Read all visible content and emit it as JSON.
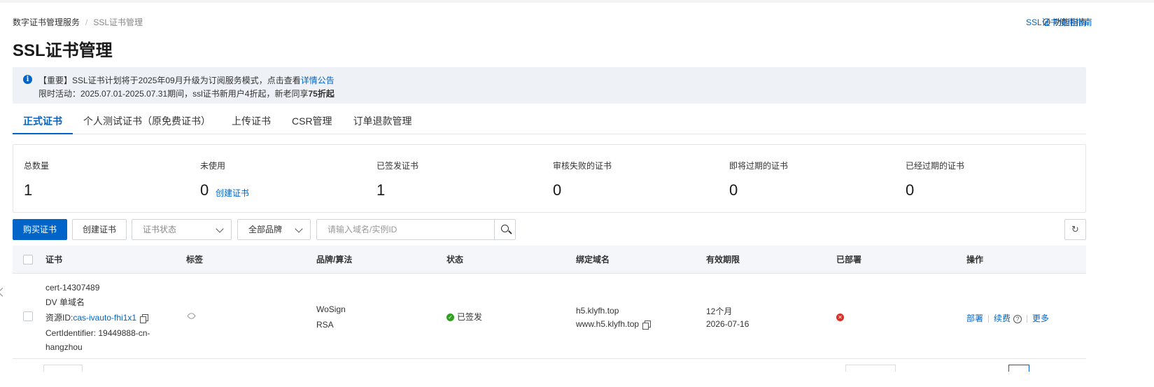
{
  "breadcrumb": {
    "root": "数字证书管理服务",
    "separator": "/",
    "current": "SSL证书管理"
  },
  "header": {
    "guide_label": "功能指南",
    "usage_guide_label": "SSL证书使用指南",
    "title": "SSL证书管理"
  },
  "notice": {
    "line1_prefix": "【重要】SSL证书计划将于2025年09月升级为订阅服务模式，点击查看",
    "line1_link": "详情公告",
    "line2_prefix": "限时活动：2025.07.01-2025.07.31期间，ssl证书新用户4折起，新老同享",
    "line2_bold": "75折起"
  },
  "tabs": [
    {
      "label": "正式证书",
      "active": true
    },
    {
      "label": "个人测试证书（原免费证书）",
      "active": false
    },
    {
      "label": "上传证书",
      "active": false
    },
    {
      "label": "CSR管理",
      "active": false
    },
    {
      "label": "订单退款管理",
      "active": false
    }
  ],
  "stats": [
    {
      "label": "总数量",
      "value": "1"
    },
    {
      "label": "未使用",
      "value": "0",
      "link": "创建证书"
    },
    {
      "label": "已签发证书",
      "value": "1"
    },
    {
      "label": "审核失败的证书",
      "value": "0"
    },
    {
      "label": "即将过期的证书",
      "value": "0"
    },
    {
      "label": "已经过期的证书",
      "value": "0"
    }
  ],
  "toolbar": {
    "buy_label": "购买证书",
    "create_label": "创建证书",
    "status_placeholder": "证书状态",
    "brand_value": "全部品牌",
    "search_placeholder": "请输入域名/实例ID",
    "refresh_glyph": "↻"
  },
  "table": {
    "columns": [
      "证书",
      "标签",
      "品牌/算法",
      "状态",
      "绑定域名",
      "有效期限",
      "已部署",
      "操作"
    ],
    "rows": [
      {
        "cert_name": "cert-14307489",
        "cert_type": "DV 单域名",
        "resource_prefix": "资源ID:",
        "resource_id": "cas-ivauto-fhi1x1",
        "identifier_line1": "CertIdentifier: 19449888-cn-",
        "identifier_line2": "hangzhou",
        "brand": "WoSign",
        "algorithm": "RSA",
        "status": "已签发",
        "domain1": "h5.klyfh.top",
        "domain2": "www.h5.klyfh.top",
        "validity": "12个月",
        "expiry": "2026-07-16",
        "actions": {
          "deploy": "部署",
          "renew": "续费",
          "more": "更多"
        }
      }
    ]
  },
  "colors": {
    "primary": "#0064c8",
    "success": "#2ea121",
    "error": "#d93026",
    "notice_bg": "#eef1f6"
  },
  "icons": [
    "info-icon",
    "guide-icon",
    "chevron-down-icon",
    "search-icon",
    "refresh-icon",
    "tag-icon",
    "copy-icon",
    "check-circle-icon",
    "error-circle-icon",
    "question-icon",
    "chevron-left-icon"
  ]
}
